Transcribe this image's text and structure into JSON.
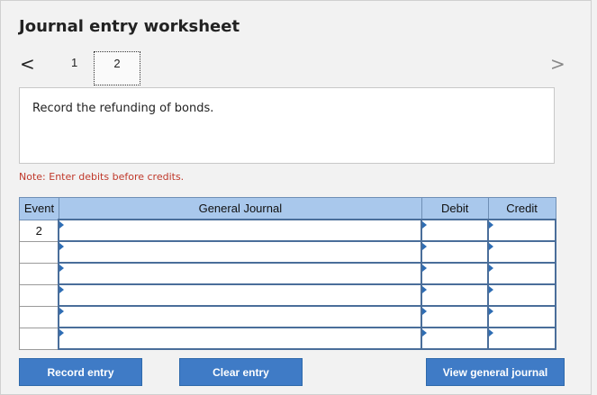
{
  "title": "Journal entry worksheet",
  "nav": {
    "prev_glyph": "<",
    "next_glyph": ">",
    "pages": [
      "1",
      "2"
    ],
    "current_page": "2"
  },
  "description": "Record the refunding of bonds.",
  "note": "Note: Enter debits before credits.",
  "table": {
    "headers": {
      "event": "Event",
      "journal": "General Journal",
      "debit": "Debit",
      "credit": "Credit"
    },
    "rows": [
      {
        "event": "2",
        "journal": "",
        "debit": "",
        "credit": ""
      },
      {
        "event": "",
        "journal": "",
        "debit": "",
        "credit": ""
      },
      {
        "event": "",
        "journal": "",
        "debit": "",
        "credit": ""
      },
      {
        "event": "",
        "journal": "",
        "debit": "",
        "credit": ""
      },
      {
        "event": "",
        "journal": "",
        "debit": "",
        "credit": ""
      },
      {
        "event": "",
        "journal": "",
        "debit": "",
        "credit": ""
      }
    ]
  },
  "buttons": {
    "record": "Record entry",
    "clear": "Clear entry",
    "view": "View general journal"
  },
  "colors": {
    "header_bg": "#a9c8ec",
    "button_bg": "#3f7bc6",
    "note_text": "#c0392b"
  }
}
